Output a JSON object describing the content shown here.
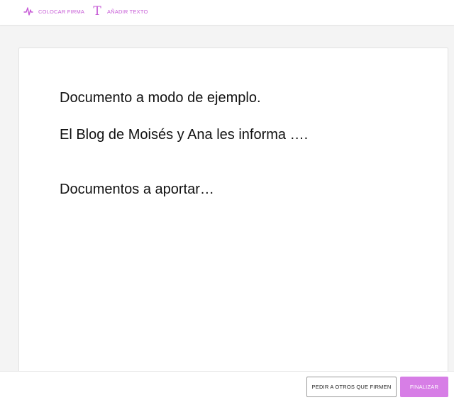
{
  "toolbar": {
    "place_signature": {
      "label": "COLOCAR FIRMA",
      "icon": "signature-icon"
    },
    "add_text": {
      "label": "AÑADIR TEXTO",
      "icon_glyph": "T",
      "icon": "text-icon"
    },
    "accent_color": "#c65ad6"
  },
  "document": {
    "lines": [
      "Documento a modo de ejemplo.",
      "El Blog de Moisés y Ana les informa ….",
      "Documentos a aportar…"
    ]
  },
  "footer": {
    "ask_others_label": "PEDIR A OTROS QUE FIRMEN",
    "finish_label": "FINALIZAR",
    "finish_color": "#d77ee6"
  }
}
